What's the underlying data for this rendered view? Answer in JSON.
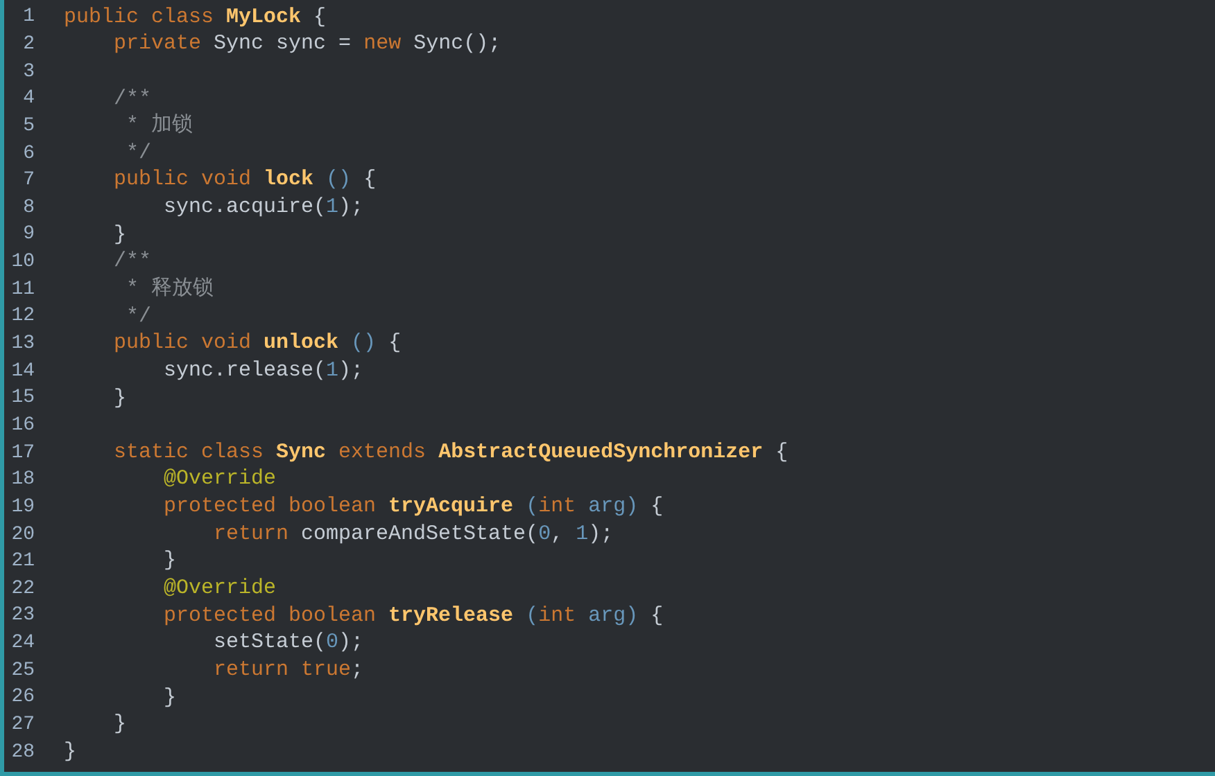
{
  "code_lines": [
    {
      "number": "1",
      "tokens": [
        {
          "text": "public class ",
          "kind": "keyword"
        },
        {
          "text": "MyLock",
          "kind": "name"
        },
        {
          "text": " {",
          "kind": "plain"
        }
      ]
    },
    {
      "number": "2",
      "tokens": [
        {
          "text": "    private ",
          "kind": "keyword"
        },
        {
          "text": "Sync sync = ",
          "kind": "plain"
        },
        {
          "text": "new ",
          "kind": "keyword"
        },
        {
          "text": "Sync();",
          "kind": "plain"
        }
      ]
    },
    {
      "number": "3"
    },
    {
      "number": "4",
      "tokens": [
        {
          "text": "    /**",
          "kind": "comment"
        }
      ]
    },
    {
      "number": "5",
      "tokens": [
        {
          "text": "     * 加锁",
          "kind": "comment"
        }
      ]
    },
    {
      "number": "6",
      "tokens": [
        {
          "text": "     */",
          "kind": "comment"
        }
      ]
    },
    {
      "number": "7",
      "tokens": [
        {
          "text": "    public void ",
          "kind": "keyword"
        },
        {
          "text": "lock",
          "kind": "name"
        },
        {
          "text": " ()",
          "kind": "punct"
        },
        {
          "text": " {",
          "kind": "plain"
        }
      ]
    },
    {
      "number": "8",
      "tokens": [
        {
          "text": "        sync.acquire(",
          "kind": "plain"
        },
        {
          "text": "1",
          "kind": "number"
        },
        {
          "text": ");",
          "kind": "plain"
        }
      ]
    },
    {
      "number": "9",
      "tokens": [
        {
          "text": "    }",
          "kind": "plain"
        }
      ]
    },
    {
      "number": "10",
      "tokens": [
        {
          "text": "    /**",
          "kind": "comment"
        }
      ]
    },
    {
      "number": "11",
      "tokens": [
        {
          "text": "     * 释放锁",
          "kind": "comment"
        }
      ]
    },
    {
      "number": "12",
      "tokens": [
        {
          "text": "     */",
          "kind": "comment"
        }
      ]
    },
    {
      "number": "13",
      "tokens": [
        {
          "text": "    public void ",
          "kind": "keyword"
        },
        {
          "text": "unlock",
          "kind": "name"
        },
        {
          "text": " ()",
          "kind": "punct"
        },
        {
          "text": " {",
          "kind": "plain"
        }
      ]
    },
    {
      "number": "14",
      "tokens": [
        {
          "text": "        sync.release(",
          "kind": "plain"
        },
        {
          "text": "1",
          "kind": "number"
        },
        {
          "text": ");",
          "kind": "plain"
        }
      ]
    },
    {
      "number": "15",
      "tokens": [
        {
          "text": "    }",
          "kind": "plain"
        }
      ]
    },
    {
      "number": "16"
    },
    {
      "number": "17",
      "tokens": [
        {
          "text": "    static class ",
          "kind": "keyword"
        },
        {
          "text": "Sync",
          "kind": "name"
        },
        {
          "text": " extends ",
          "kind": "keyword"
        },
        {
          "text": "AbstractQueuedSynchronizer",
          "kind": "name"
        },
        {
          "text": " {",
          "kind": "plain"
        }
      ]
    },
    {
      "number": "18",
      "tokens": [
        {
          "text": "        @Override",
          "kind": "annotation"
        }
      ]
    },
    {
      "number": "19",
      "tokens": [
        {
          "text": "        protected boolean ",
          "kind": "keyword"
        },
        {
          "text": "tryAcquire",
          "kind": "name"
        },
        {
          "text": " (",
          "kind": "punct"
        },
        {
          "text": "int ",
          "kind": "keyword"
        },
        {
          "text": "arg)",
          "kind": "punct"
        },
        {
          "text": " {",
          "kind": "plain"
        }
      ]
    },
    {
      "number": "20",
      "tokens": [
        {
          "text": "            return ",
          "kind": "keyword"
        },
        {
          "text": "compareAndSetState(",
          "kind": "plain"
        },
        {
          "text": "0",
          "kind": "number"
        },
        {
          "text": ", ",
          "kind": "plain"
        },
        {
          "text": "1",
          "kind": "number"
        },
        {
          "text": ");",
          "kind": "plain"
        }
      ]
    },
    {
      "number": "21",
      "tokens": [
        {
          "text": "        }",
          "kind": "plain"
        }
      ]
    },
    {
      "number": "22",
      "tokens": [
        {
          "text": "        @Override",
          "kind": "annotation"
        }
      ]
    },
    {
      "number": "23",
      "tokens": [
        {
          "text": "        protected boolean ",
          "kind": "keyword"
        },
        {
          "text": "tryRelease",
          "kind": "name"
        },
        {
          "text": " (",
          "kind": "punct"
        },
        {
          "text": "int ",
          "kind": "keyword"
        },
        {
          "text": "arg)",
          "kind": "punct"
        },
        {
          "text": " {",
          "kind": "plain"
        }
      ]
    },
    {
      "number": "24",
      "tokens": [
        {
          "text": "            setState(",
          "kind": "plain"
        },
        {
          "text": "0",
          "kind": "number"
        },
        {
          "text": ");",
          "kind": "plain"
        }
      ]
    },
    {
      "number": "25",
      "tokens": [
        {
          "text": "            return true",
          "kind": "keyword"
        },
        {
          "text": ";",
          "kind": "plain"
        }
      ]
    },
    {
      "number": "26",
      "tokens": [
        {
          "text": "        }",
          "kind": "plain"
        }
      ]
    },
    {
      "number": "27",
      "tokens": [
        {
          "text": "    }",
          "kind": "plain"
        }
      ]
    },
    {
      "number": "28",
      "tokens": [
        {
          "text": "}",
          "kind": "plain"
        }
      ]
    }
  ]
}
